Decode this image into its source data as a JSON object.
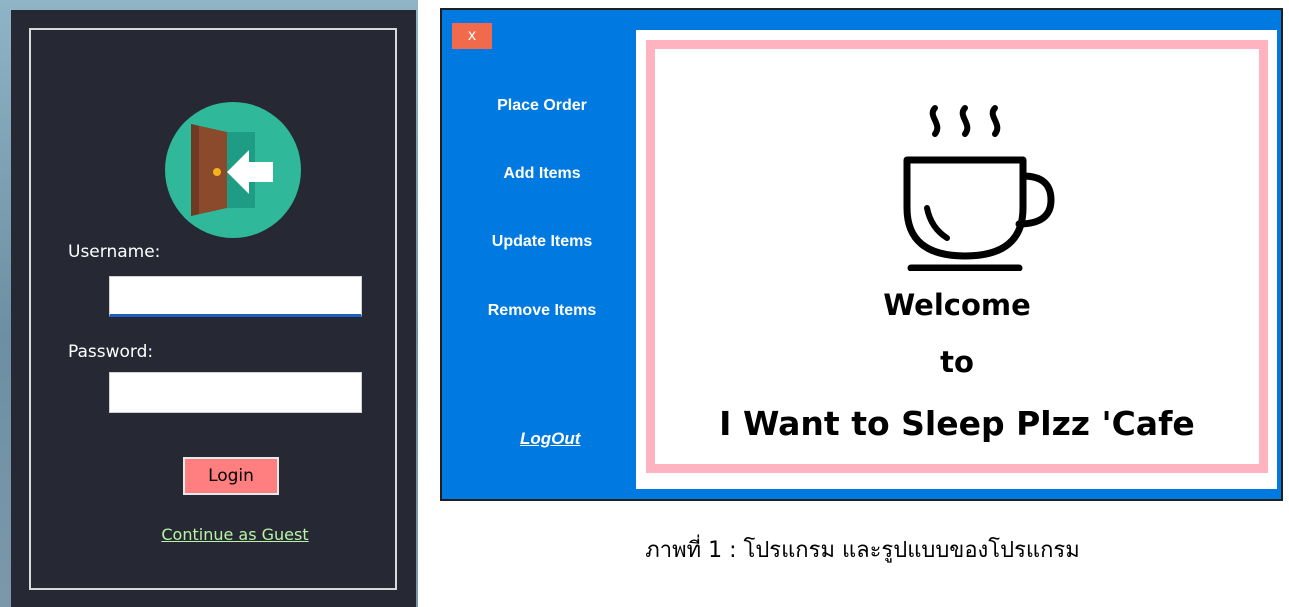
{
  "login": {
    "username_label": "Username:",
    "username_value": "",
    "password_label": "Password:",
    "password_value": "",
    "login_button": "Login",
    "guest_link": "Continue as Guest",
    "avatar_icon": "door-enter-icon"
  },
  "main_window": {
    "close_button": "x",
    "nav": [
      "Place Order",
      "Add Items",
      "Update Items",
      "Remove Items"
    ],
    "logout": "LogOut",
    "welcome": [
      "Welcome",
      "to",
      "I Want to Sleep Plzz 'Cafe"
    ],
    "hero_icon": "coffee-cup-icon"
  },
  "caption": "ภาพที่ 1 : โปรแกรม และรูปแบบของโปรแกรม",
  "colors": {
    "login_panel": "#262933",
    "avatar_bg": "#2fb89a",
    "login_button": "#ff7f80",
    "guest_link": "#b9f3a6",
    "window_blue": "#0079e0",
    "close_button": "#f16a4b",
    "pink_border": "#ffb3c0"
  }
}
